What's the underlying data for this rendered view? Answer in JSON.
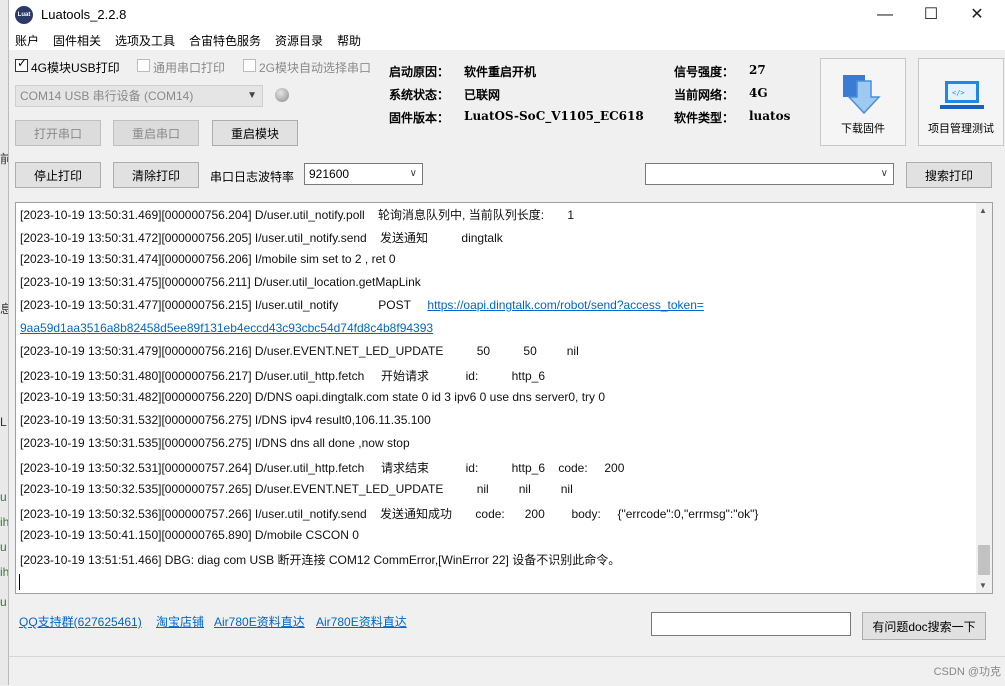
{
  "window": {
    "title": "Luatools_2.2.8",
    "icon_name": "luat-logo-icon",
    "minimize": "—",
    "maximize": "☐",
    "close": "✕"
  },
  "menu": [
    "账户",
    "固件相关",
    "选项及工具",
    "合宙特色服务",
    "资源目录",
    "帮助"
  ],
  "options": {
    "usb_print": {
      "label": "4G模块USB打印",
      "checked": true
    },
    "serial_print": {
      "label": "通用串口打印",
      "checked": false
    },
    "auto_select": {
      "label": "2G模块自动选择串口",
      "checked": false
    }
  },
  "port_select": {
    "value": "COM14 USB 串行设备 (COM14)"
  },
  "buttons": {
    "open_port": "打开串口",
    "restart_port": "重启串口",
    "restart_module": "重启模块",
    "stop_print": "停止打印",
    "clear_print": "清除打印",
    "search_print": "搜索打印",
    "doc_search": "有问题doc搜索一下"
  },
  "baud": {
    "label": "串口日志波特率",
    "value": "921600"
  },
  "status": {
    "boot_reason_label": "启动原因：",
    "boot_reason": "软件重启开机",
    "system_state_label": "系统状态：",
    "system_state": "已联网",
    "firmware_label": "固件版本：",
    "firmware": "LuatOS-SoC_V1105_EC618",
    "signal_label": "信号强度：",
    "signal": "27",
    "network_label": "当前网络：",
    "network": "4G",
    "software_type_label": "软件类型：",
    "software_type": "luatos"
  },
  "tools": {
    "download_label": "下载固件",
    "project_label": "项目管理测试"
  },
  "log": [
    {
      "text": "[2023-10-19 13:50:31.469][000000756.204] D/user.util_notify.poll    轮询消息队列中, 当前队列长度:       1"
    },
    {
      "text": "[2023-10-19 13:50:31.472][000000756.205] I/user.util_notify.send    发送通知          dingtalk"
    },
    {
      "text": "[2023-10-19 13:50:31.474][000000756.206] I/mobile sim set to 2 , ret 0"
    },
    {
      "text": "[2023-10-19 13:50:31.475][000000756.211] D/user.util_location.getMapLink"
    },
    {
      "text": "[2023-10-19 13:50:31.477][000000756.215] I/user.util_notify            POST     ",
      "link": "https://oapi.dingtalk.com/robot/send?access_token="
    },
    {
      "text": "",
      "link": "9aa59d1aa3516a8b82458d5ee89f131eb4eccd43c93cbc54d74fd8c4b8f94393"
    },
    {
      "text": "[2023-10-19 13:50:31.479][000000756.216] D/user.EVENT.NET_LED_UPDATE          50          50         nil"
    },
    {
      "text": "[2023-10-19 13:50:31.480][000000756.217] D/user.util_http.fetch     开始请求           id:          http_6"
    },
    {
      "text": "[2023-10-19 13:50:31.482][000000756.220] D/DNS oapi.dingtalk.com state 0 id 3 ipv6 0 use dns server0, try 0"
    },
    {
      "text": "[2023-10-19 13:50:31.532][000000756.275] I/DNS ipv4 result0,106.11.35.100"
    },
    {
      "text": "[2023-10-19 13:50:31.535][000000756.275] I/DNS dns all done ,now stop"
    },
    {
      "text": "[2023-10-19 13:50:32.531][000000757.264] D/user.util_http.fetch     请求结束           id:          http_6    code:     200"
    },
    {
      "text": "[2023-10-19 13:50:32.535][000000757.265] D/user.EVENT.NET_LED_UPDATE          nil         nil         nil"
    },
    {
      "text": "[2023-10-19 13:50:32.536][000000757.266] I/user.util_notify.send    发送通知成功       code:      200        body:     {\"errcode\":0,\"errmsg\":\"ok\"}"
    },
    {
      "text": "[2023-10-19 13:50:41.150][000000765.890] D/mobile CSCON 0"
    },
    {
      "text": "[2023-10-19 13:51:51.466] DBG: diag com USB 断开连接 COM12 CommError,[WinError 22] 设备不识别此命令。"
    }
  ],
  "links": [
    "QQ支持群(627625461)",
    "淘宝店铺",
    "Air780E资料直达",
    "Air780E资料直达"
  ],
  "search_input": {
    "value": ""
  },
  "watermark": "CSDN @功克"
}
